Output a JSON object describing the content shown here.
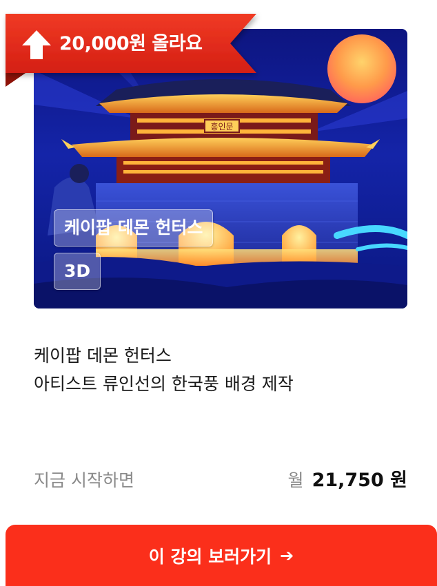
{
  "badge": {
    "text": "20,000원 올라요",
    "icon": "up-arrow-icon",
    "color": "#e8281c"
  },
  "thumbnail": {
    "title_chip": "케이팝 데몬 헌터스",
    "format_chip": "3D",
    "sign_text": "흥인문"
  },
  "course": {
    "title_line1": "케이팝 데몬 헌터스",
    "title_line2": "아티스트 류인선의 한국풍 배경 제작"
  },
  "pricing": {
    "start_label": "지금 시작하면",
    "prefix": "월",
    "amount": "21,750 원"
  },
  "cta": {
    "label": "이 강의 보러가기",
    "icon": "arrow-right-icon",
    "color": "#fb2f1b"
  }
}
